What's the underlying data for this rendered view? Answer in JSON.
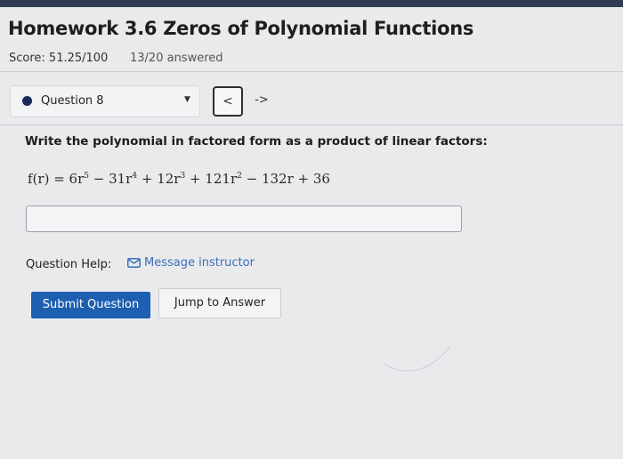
{
  "page": {
    "title": "Homework 3.6 Zeros of Polynomial Functions",
    "score": "Score: 51.25/100",
    "answered": "13/20 answered"
  },
  "question_nav": {
    "selected": "Question 8",
    "prev_label": "<",
    "next_label": "->"
  },
  "question": {
    "prompt": "Write the polynomial in factored form as a product of linear factors:",
    "formula": {
      "lhs": "f(r) = 6r",
      "e1": "5",
      "t2": " − 31r",
      "e2": "4",
      "t3": " + 12r",
      "e3": "3",
      "t4": " + 121r",
      "e4": "2",
      "t5": " − 132r + 36"
    },
    "answer_value": ""
  },
  "help": {
    "label": "Question Help:",
    "message_link": "Message instructor"
  },
  "actions": {
    "submit": "Submit Question",
    "jump": "Jump to Answer"
  },
  "colors": {
    "accent": "#1d5fb0",
    "link": "#3b6fb8",
    "topbar": "#2f3e52"
  }
}
